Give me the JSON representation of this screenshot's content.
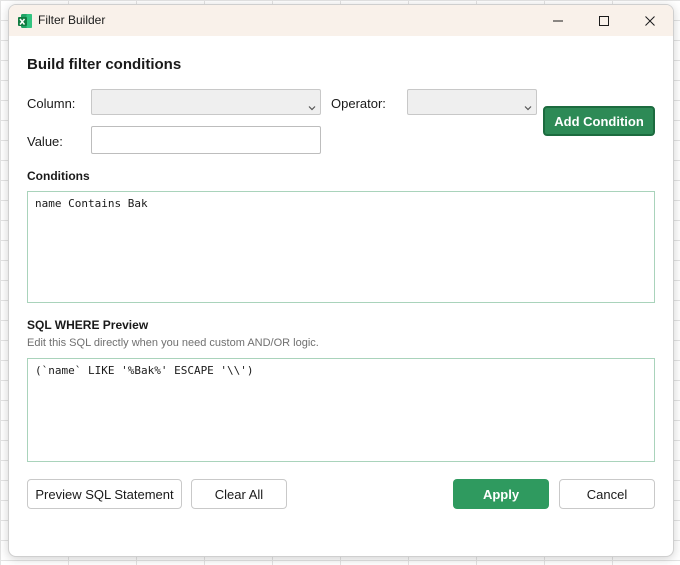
{
  "window": {
    "title": "Filter Builder",
    "icon": "excel-icon"
  },
  "colors": {
    "accent": "#2f9a5f",
    "accent_dark": "#1c6b3f",
    "titlebar_bg": "#f9f1ea",
    "textbox_border": "#a9d3bb"
  },
  "form": {
    "heading": "Build filter conditions",
    "column_label": "Column:",
    "column_value": "",
    "operator_label": "Operator:",
    "operator_value": "",
    "value_label": "Value:",
    "value_text": "",
    "add_condition_label": "Add Condition"
  },
  "conditions": {
    "title": "Conditions",
    "text": "name Contains Bak"
  },
  "sql_preview": {
    "title": "SQL WHERE Preview",
    "hint": "Edit this SQL directly when you need custom AND/OR logic.",
    "text": "(`name` LIKE '%Bak%' ESCAPE '\\\\')"
  },
  "footer": {
    "preview_sql_label": "Preview SQL Statement",
    "clear_all_label": "Clear All",
    "apply_label": "Apply",
    "cancel_label": "Cancel"
  }
}
